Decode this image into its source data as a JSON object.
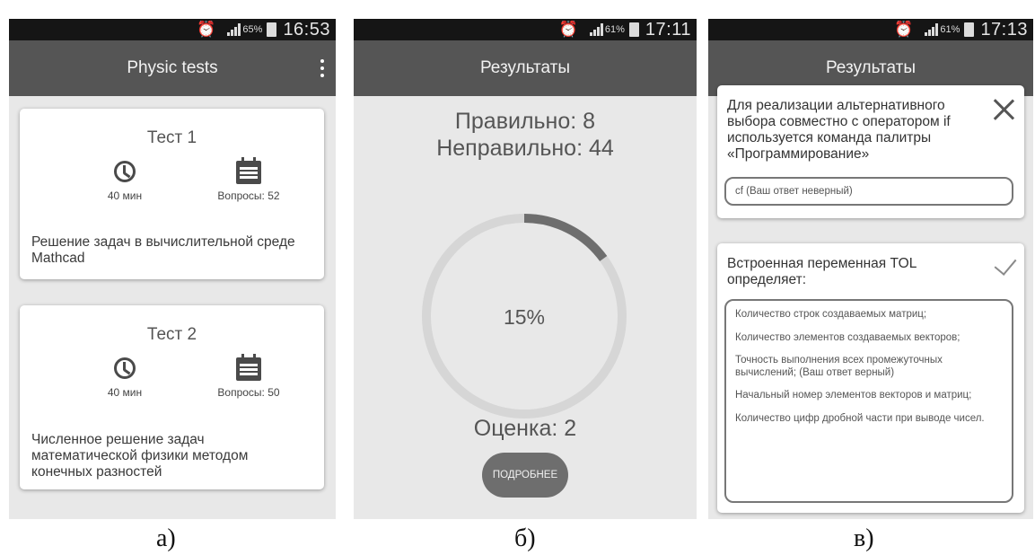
{
  "colors": {
    "status_bar": "#151515",
    "app_bar": "#555555",
    "screen_bg": "#e8e8e8",
    "card_bg": "#ffffff",
    "ring_track": "#d6d6d6",
    "ring_progress": "#6e6e6e",
    "button": "#6e6e6e"
  },
  "screen_a": {
    "status": {
      "battery": "65%",
      "time": "16:53",
      "icons": [
        "alarm-icon",
        "signal-icon",
        "battery-icon"
      ]
    },
    "app_title": "Physic tests",
    "menu_icon": "more-vert-icon",
    "tests": [
      {
        "title": "Тест 1",
        "duration": "40 мин",
        "questions": "Вопросы: 52",
        "description": "Решение задач в вычислительной среде Mathcad"
      },
      {
        "title": "Тест 2",
        "duration": "40 мин",
        "questions": "Вопросы: 50",
        "description": "Численное решение задач математической физики методом конечных разностей"
      }
    ]
  },
  "screen_b": {
    "status": {
      "battery": "61%",
      "time": "17:11"
    },
    "app_title": "Результаты",
    "correct": "Правильно: 8",
    "wrong": "Неправильно: 44",
    "percent_label": "15%",
    "progress": 0.15,
    "grade": "Оценка: 2",
    "details_button": "ПОДРОБНЕЕ"
  },
  "screen_c": {
    "status": {
      "battery": "61%",
      "time": "17:13"
    },
    "app_title": "Результаты",
    "q1": {
      "text": "Для реализации альтернативного выбора совместно с оператором if используется команда палитры «Программирование»",
      "answer": "cf (Ваш ответ неверный)",
      "status_icon": "close-icon"
    },
    "q2": {
      "text": "Встроенная переменная TOL определяет:",
      "status_icon": "check-icon",
      "options": [
        "Количество строк создаваемых матриц;",
        "Количество элементов создаваемых векторов;",
        "Точность выполнения всех промежуточных вычислений; (Ваш ответ верный)",
        "Начальный номер элементов векторов и матриц;",
        "Количество цифр дробной части при выводе чисел."
      ]
    }
  },
  "captions": {
    "a": "а)",
    "b": "б)",
    "c": "в)"
  }
}
